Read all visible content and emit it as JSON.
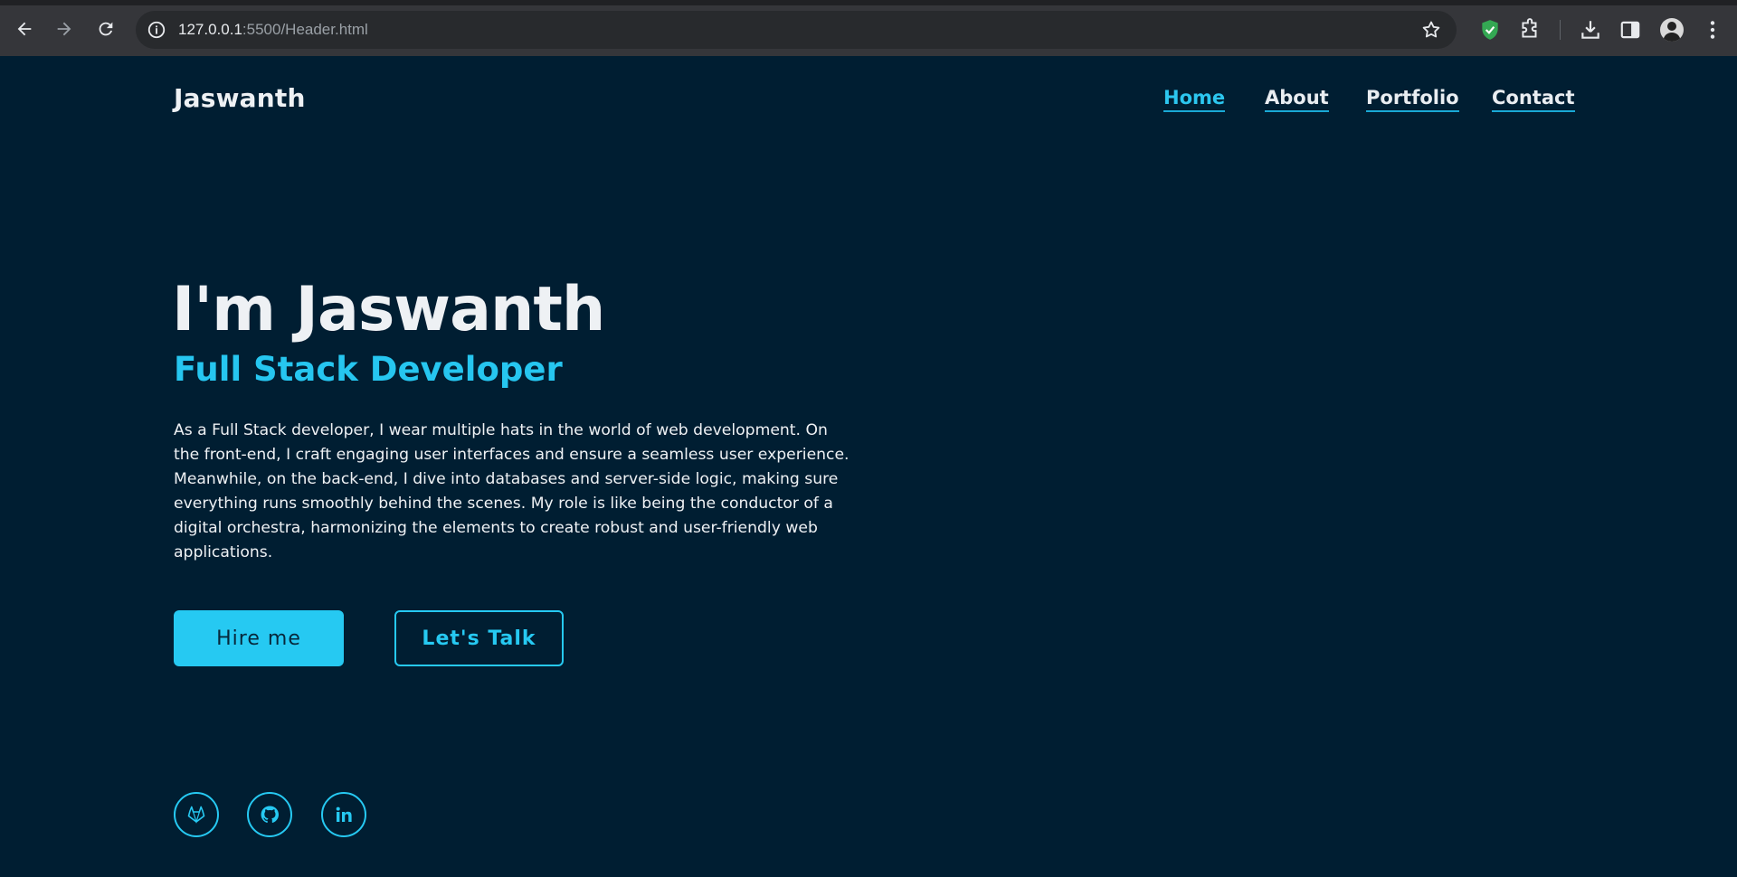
{
  "browser": {
    "url_host": "127.0.0.1",
    "url_path": ":5500/Header.html"
  },
  "header": {
    "brand": "Jaswanth",
    "nav": [
      {
        "label": "Home",
        "active": true
      },
      {
        "label": "About",
        "active": false
      },
      {
        "label": "Portfolio",
        "active": false
      },
      {
        "label": "Contact",
        "active": false
      }
    ]
  },
  "hero": {
    "title": "I'm Jaswanth",
    "subtitle": "Full Stack Developer",
    "description": "As a Full Stack developer, I wear multiple hats in the world of web development. On the front-end, I craft engaging user interfaces and ensure a seamless user experience. Meanwhile, on the back-end, I dive into databases and server-side logic, making sure everything runs smoothly behind the scenes. My role is like being the conductor of a digital orchestra, harmonizing the elements to create robust and user-friendly web applications.",
    "primary_button": "Hire me",
    "secondary_button": "Let's Talk"
  },
  "social": [
    {
      "icon": "gitlab-icon"
    },
    {
      "icon": "github-icon"
    },
    {
      "icon": "linkedin-icon"
    }
  ],
  "colors": {
    "background": "#001e32",
    "accent": "#26c9f2",
    "text": "#eef1f4"
  }
}
